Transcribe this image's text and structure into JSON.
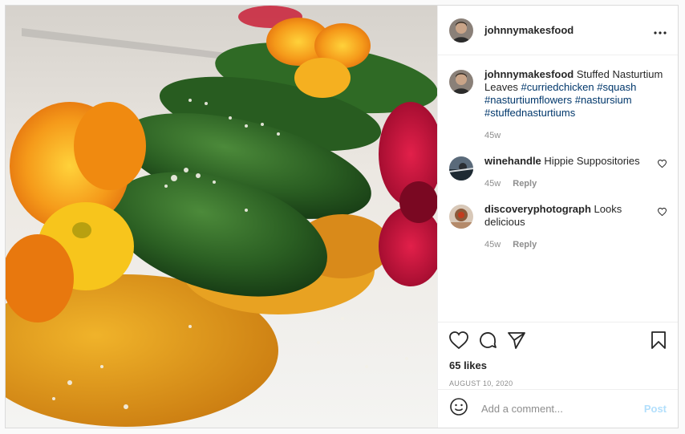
{
  "post": {
    "author": "johnnymakesfood",
    "menu_icon": "more-horizontal-icon",
    "caption": {
      "username": "johnnymakesfood",
      "text": "Stuffed Nasturtium Leaves",
      "hashtags": [
        "#curriedchicken",
        "#squash",
        "#nasturtiumflowers",
        "#nastursium",
        "#stuffednasturtiums"
      ],
      "time": "45w"
    },
    "comments": [
      {
        "username": "winehandle",
        "text": "Hippie Suppositories",
        "time": "45w",
        "reply_label": "Reply"
      },
      {
        "username": "discoveryphotograph",
        "text": "Looks delicious",
        "time": "45w",
        "reply_label": "Reply"
      }
    ],
    "likes": "65 likes",
    "date": "AUGUST 10, 2020",
    "add_comment": {
      "placeholder": "Add a comment...",
      "post_label": "Post"
    },
    "colors": {
      "link": "#00376b",
      "muted": "#8e8e8e",
      "post_disabled": "#b2dffc"
    }
  }
}
